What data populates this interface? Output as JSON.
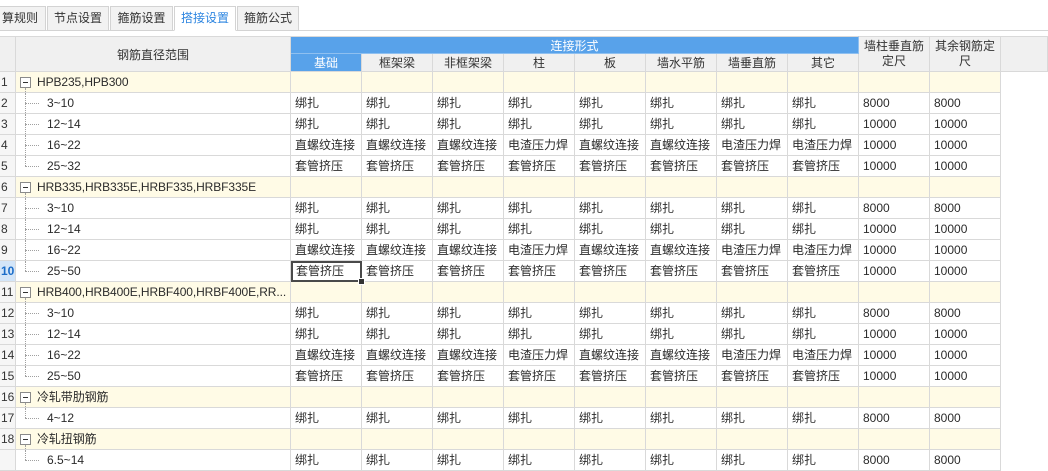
{
  "tabs": [
    {
      "label": "算规则",
      "active": false
    },
    {
      "label": "节点设置",
      "active": false
    },
    {
      "label": "箍筋设置",
      "active": false
    },
    {
      "label": "搭接设置",
      "active": true
    },
    {
      "label": "箍筋公式",
      "active": false
    }
  ],
  "colors": {
    "accent": "#58a2ea",
    "group_row_background": "#fffbe6",
    "active_tab_text": "#2b84e0",
    "selected_row_number": "#1a6cc8",
    "grid_line": "#d9d9d9",
    "header_background": "#f0f0f0"
  },
  "icons": {
    "group_toggle": "minus-box-icon"
  },
  "table": {
    "header": {
      "range": "钢筋直径范围",
      "connection_type": "连接形式",
      "columns": [
        "基础",
        "框架梁",
        "非框架梁",
        "柱",
        "板",
        "墙水平筋",
        "墙垂直筋",
        "其它"
      ],
      "wall_column_vertical_length": "墙柱垂直筋定尺",
      "other_length": "其余钢筋定尺"
    },
    "rows": [
      {
        "num": "1",
        "group": "HPB235,HPB300",
        "expanded": true
      },
      {
        "num": "2",
        "range": "3~10",
        "values": [
          "绑扎",
          "绑扎",
          "绑扎",
          "绑扎",
          "绑扎",
          "绑扎",
          "绑扎",
          "绑扎"
        ],
        "wall_column_vertical_length": "8000",
        "other_length": "8000"
      },
      {
        "num": "3",
        "range": "12~14",
        "values": [
          "绑扎",
          "绑扎",
          "绑扎",
          "绑扎",
          "绑扎",
          "绑扎",
          "绑扎",
          "绑扎"
        ],
        "wall_column_vertical_length": "10000",
        "other_length": "10000"
      },
      {
        "num": "4",
        "range": "16~22",
        "values": [
          "直螺纹连接",
          "直螺纹连接",
          "直螺纹连接",
          "电渣压力焊",
          "直螺纹连接",
          "直螺纹连接",
          "电渣压力焊",
          "电渣压力焊"
        ],
        "wall_column_vertical_length": "10000",
        "other_length": "10000"
      },
      {
        "num": "5",
        "range": "25~32",
        "values": [
          "套管挤压",
          "套管挤压",
          "套管挤压",
          "套管挤压",
          "套管挤压",
          "套管挤压",
          "套管挤压",
          "套管挤压"
        ],
        "wall_column_vertical_length": "10000",
        "other_length": "10000"
      },
      {
        "num": "6",
        "group": "HRB335,HRB335E,HRBF335,HRBF335E",
        "expanded": true
      },
      {
        "num": "7",
        "range": "3~10",
        "values": [
          "绑扎",
          "绑扎",
          "绑扎",
          "绑扎",
          "绑扎",
          "绑扎",
          "绑扎",
          "绑扎"
        ],
        "wall_column_vertical_length": "8000",
        "other_length": "8000"
      },
      {
        "num": "8",
        "range": "12~14",
        "values": [
          "绑扎",
          "绑扎",
          "绑扎",
          "绑扎",
          "绑扎",
          "绑扎",
          "绑扎",
          "绑扎"
        ],
        "wall_column_vertical_length": "10000",
        "other_length": "10000"
      },
      {
        "num": "9",
        "range": "16~22",
        "values": [
          "直螺纹连接",
          "直螺纹连接",
          "直螺纹连接",
          "电渣压力焊",
          "直螺纹连接",
          "直螺纹连接",
          "电渣压力焊",
          "电渣压力焊"
        ],
        "wall_column_vertical_length": "10000",
        "other_length": "10000"
      },
      {
        "num": "10",
        "range": "25~50",
        "values": [
          "套管挤压",
          "套管挤压",
          "套管挤压",
          "套管挤压",
          "套管挤压",
          "套管挤压",
          "套管挤压",
          "套管挤压"
        ],
        "wall_column_vertical_length": "10000",
        "other_length": "10000",
        "selected_cell": 0
      },
      {
        "num": "11",
        "group": "HRB400,HRB400E,HRBF400,HRBF400E,RR...",
        "expanded": true
      },
      {
        "num": "12",
        "range": "3~10",
        "values": [
          "绑扎",
          "绑扎",
          "绑扎",
          "绑扎",
          "绑扎",
          "绑扎",
          "绑扎",
          "绑扎"
        ],
        "wall_column_vertical_length": "8000",
        "other_length": "8000"
      },
      {
        "num": "13",
        "range": "12~14",
        "values": [
          "绑扎",
          "绑扎",
          "绑扎",
          "绑扎",
          "绑扎",
          "绑扎",
          "绑扎",
          "绑扎"
        ],
        "wall_column_vertical_length": "10000",
        "other_length": "10000"
      },
      {
        "num": "14",
        "range": "16~22",
        "values": [
          "直螺纹连接",
          "直螺纹连接",
          "直螺纹连接",
          "电渣压力焊",
          "直螺纹连接",
          "直螺纹连接",
          "电渣压力焊",
          "电渣压力焊"
        ],
        "wall_column_vertical_length": "10000",
        "other_length": "10000"
      },
      {
        "num": "15",
        "range": "25~50",
        "values": [
          "套管挤压",
          "套管挤压",
          "套管挤压",
          "套管挤压",
          "套管挤压",
          "套管挤压",
          "套管挤压",
          "套管挤压"
        ],
        "wall_column_vertical_length": "10000",
        "other_length": "10000"
      },
      {
        "num": "16",
        "group": "冷轧带肋钢筋",
        "expanded": true
      },
      {
        "num": "17",
        "range": "4~12",
        "values": [
          "绑扎",
          "绑扎",
          "绑扎",
          "绑扎",
          "绑扎",
          "绑扎",
          "绑扎",
          "绑扎"
        ],
        "wall_column_vertical_length": "8000",
        "other_length": "8000"
      },
      {
        "num": "18",
        "group": "冷轧扭钢筋",
        "expanded": true
      },
      {
        "range": "6.5~14",
        "values": [
          "绑扎",
          "绑扎",
          "绑扎",
          "绑扎",
          "绑扎",
          "绑扎",
          "绑扎",
          "绑扎"
        ],
        "wall_column_vertical_length": "8000",
        "other_length": "8000"
      }
    ]
  }
}
